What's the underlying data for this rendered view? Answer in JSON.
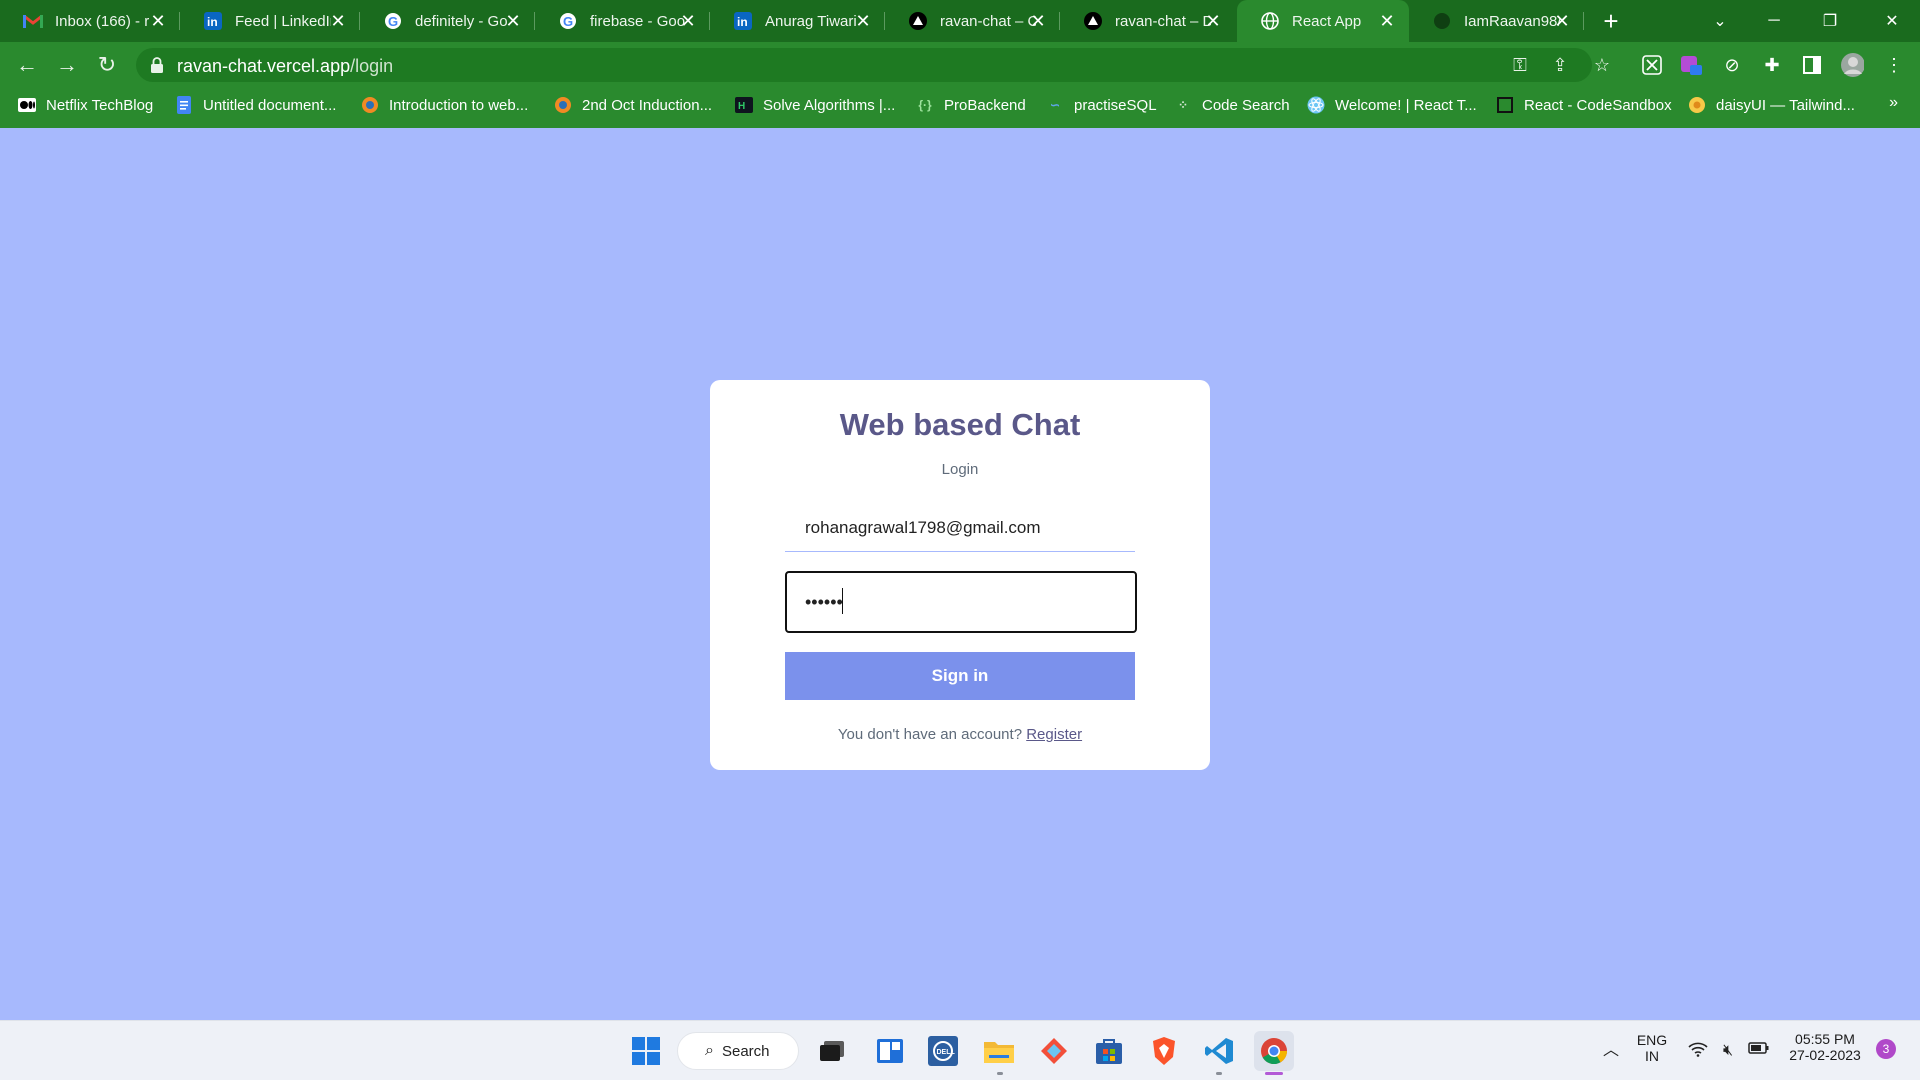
{
  "browser": {
    "tabs": [
      {
        "title": "Inbox (166) - r",
        "favicon": "gmail-icon"
      },
      {
        "title": "Feed | LinkedIn",
        "favicon": "linkedin-icon"
      },
      {
        "title": "definitely - Go",
        "favicon": "google-icon"
      },
      {
        "title": "firebase - Goo",
        "favicon": "google-icon"
      },
      {
        "title": "Anurag Tiwari",
        "favicon": "linkedin-icon"
      },
      {
        "title": "ravan-chat – C",
        "favicon": "vercel-icon"
      },
      {
        "title": "ravan-chat – D",
        "favicon": "vercel-icon"
      },
      {
        "title": "React App",
        "favicon": "globe-icon"
      },
      {
        "title": "IamRaavan98/",
        "favicon": "github-icon"
      }
    ],
    "active_tab": 7,
    "url_host": "ravan-chat.vercel.app",
    "url_path": "/login",
    "bookmarks": [
      {
        "label": "Netflix TechBlog",
        "icon": "medium-icon"
      },
      {
        "label": "Untitled document...",
        "icon": "docs-icon"
      },
      {
        "label": "Introduction to web...",
        "icon": "orange-circle-icon"
      },
      {
        "label": "2nd Oct Induction...",
        "icon": "orange-circle-icon"
      },
      {
        "label": "Solve Algorithms |...",
        "icon": "hackerrank-icon"
      },
      {
        "label": "ProBackend",
        "icon": "code-braces-icon"
      },
      {
        "label": "practiseSQL",
        "icon": "sql-icon"
      },
      {
        "label": "Code Search",
        "icon": "dots-grid-icon"
      },
      {
        "label": "Welcome! | React T...",
        "icon": "react-icon"
      },
      {
        "label": "React - CodeSandbox",
        "icon": "codesandbox-icon"
      },
      {
        "label": "daisyUI — Tailwind...",
        "icon": "flower-icon"
      }
    ],
    "more_bookmarks": "»"
  },
  "login": {
    "title": "Web based Chat",
    "subtitle": "Login",
    "email_value": "rohanagrawal1798@gmail.com",
    "password_mask": "••••••",
    "signin_label": "Sign in",
    "no_account_text": "You don't have an account?",
    "register_label": "Register"
  },
  "taskbar": {
    "search_label": "Search",
    "lang_top": "ENG",
    "lang_bottom": "IN",
    "time": "05:55 PM",
    "date": "27-02-2023",
    "notification_count": "3"
  },
  "colors": {
    "page_bg": "#a7b9fd",
    "browser_green": "#2a8a2e",
    "title_purple": "#5a5889",
    "button_blue": "#7b91ec"
  }
}
